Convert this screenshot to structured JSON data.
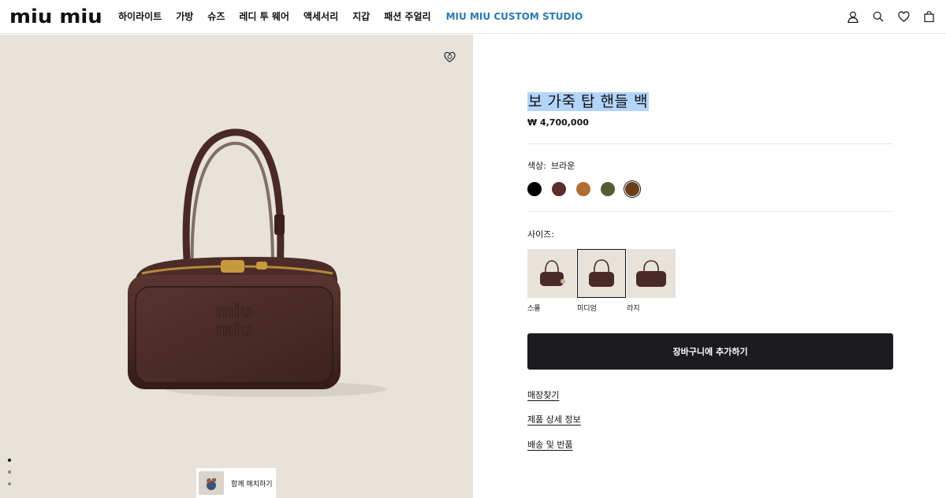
{
  "brand": {
    "logo": "MIU MIU"
  },
  "nav": {
    "items": [
      "하이라이트",
      "가방",
      "슈즈",
      "레디 투 웨어",
      "액세서리",
      "지갑",
      "패션 주얼리"
    ],
    "accent_item": "MIU MIU CUSTOM STUDIO",
    "accent_color": "#2a7ab0"
  },
  "header_icons": [
    "account-icon",
    "search-icon",
    "wishlist-icon",
    "bag-icon"
  ],
  "gallery": {
    "background": "#e8e3da",
    "pager_count": 3,
    "pager_active": 1,
    "match_label": "함께 매치하기"
  },
  "product": {
    "title": "보 가죽 탑 핸들 백",
    "price": "₩ 4,700,000",
    "color_label": "색상:",
    "color_value": "브라운",
    "swatches": [
      {
        "name": "black",
        "hex": "#000000",
        "selected": false
      },
      {
        "name": "burgundy",
        "hex": "#5a2c2a",
        "selected": false
      },
      {
        "name": "cognac",
        "hex": "#b06d33",
        "selected": false
      },
      {
        "name": "olive",
        "hex": "#5a5b35",
        "selected": false
      },
      {
        "name": "brown",
        "hex": "#6b3e1a",
        "selected": true
      }
    ],
    "size_label": "사이즈:",
    "sizes": [
      {
        "label": "스몰",
        "selected": false
      },
      {
        "label": "미디엄",
        "selected": true
      },
      {
        "label": "라지",
        "selected": false
      }
    ],
    "cart_button": "장바구니에 추가하기",
    "links": [
      "매장찾기",
      "제품 상세 정보",
      "배송 및 반품"
    ]
  }
}
